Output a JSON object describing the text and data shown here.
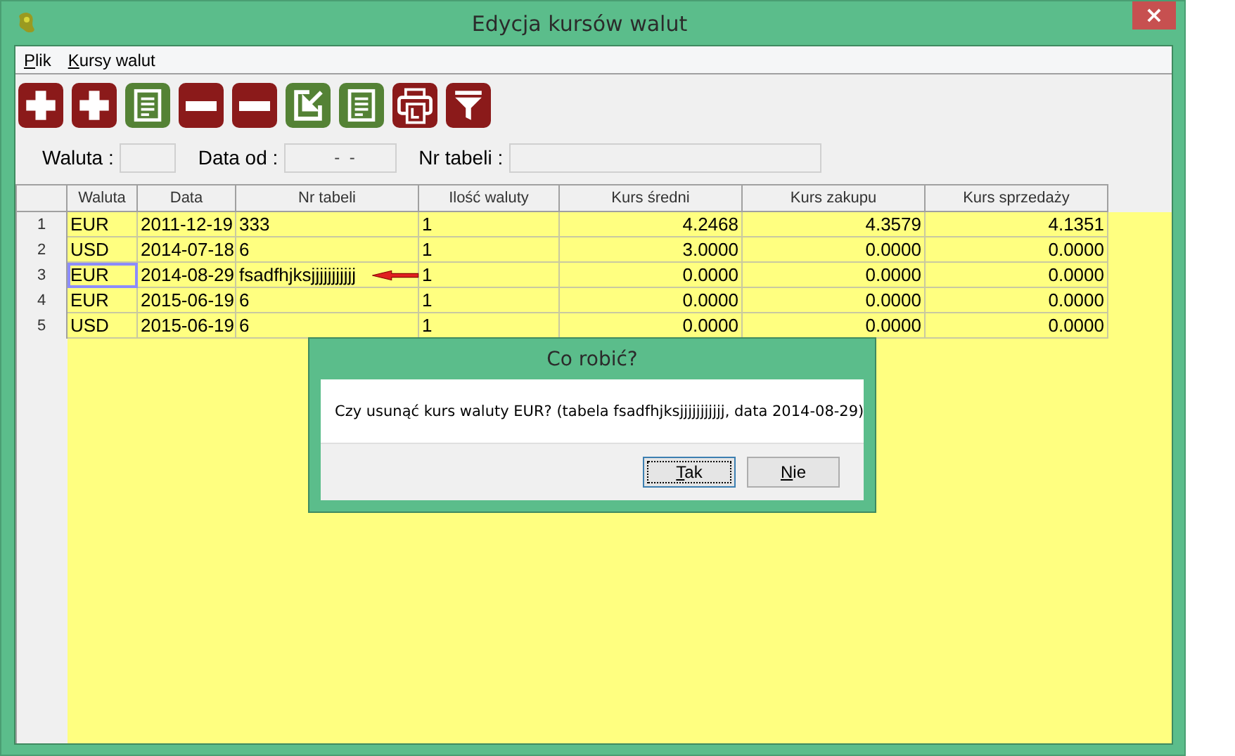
{
  "window": {
    "title": "Edycja kursów walut",
    "close": "×"
  },
  "menu": [
    {
      "label": "Plik",
      "mnemonic_first": true
    },
    {
      "label": "Kursy walut",
      "mnemonic_first": true
    }
  ],
  "toolbar": [
    {
      "kind": "add"
    },
    {
      "kind": "add"
    },
    {
      "kind": "list"
    },
    {
      "kind": "remove"
    },
    {
      "kind": "remove"
    },
    {
      "kind": "export"
    },
    {
      "kind": "list"
    },
    {
      "kind": "print"
    },
    {
      "kind": "filter"
    }
  ],
  "filters": [
    {
      "label": "Waluta :"
    },
    {
      "label": "Data od :",
      "value": "  -  -"
    },
    {
      "label": "Nr tabeli :"
    }
  ],
  "table": {
    "columns": [
      "Waluta",
      "Data",
      "Nr tabeli",
      "Ilość waluty",
      "Kurs średni",
      "Kurs zakupu",
      "Kurs sprzedaży"
    ],
    "rows": [
      {
        "number": "1",
        "selected": false,
        "cells": [
          "EUR",
          "2011-12-19",
          "333",
          "1",
          "4.2468",
          "4.3579",
          "4.1351"
        ]
      },
      {
        "number": "2",
        "selected": false,
        "cells": [
          "USD",
          "2014-07-18",
          "6",
          "1",
          "3.0000",
          "0.0000",
          "0.0000"
        ]
      },
      {
        "number": "3",
        "selected": true,
        "cells": [
          "EUR",
          "2014-08-29",
          "fsadfhjksjjjjjjjjjjj",
          "1",
          "0.0000",
          "0.0000",
          "0.0000"
        ]
      },
      {
        "number": "4",
        "selected": false,
        "cells": [
          "EUR",
          "2015-06-19",
          "6",
          "1",
          "0.0000",
          "0.0000",
          "0.0000"
        ]
      },
      {
        "number": "5",
        "selected": false,
        "cells": [
          "USD",
          "2015-06-19",
          "6",
          "1",
          "0.0000",
          "0.0000",
          "0.0000"
        ]
      }
    ]
  },
  "dialog": {
    "title": "Co robić?",
    "message": "Czy usunąć kurs waluty EUR? (tabela fsadfhjksjjjjjjjjjjj, data 2014-08-29)",
    "buttons": [
      {
        "label": "Tak",
        "mnemonic_first": true,
        "default": true
      },
      {
        "label": "Nie",
        "mnemonic_first": true,
        "default": false
      }
    ]
  }
}
